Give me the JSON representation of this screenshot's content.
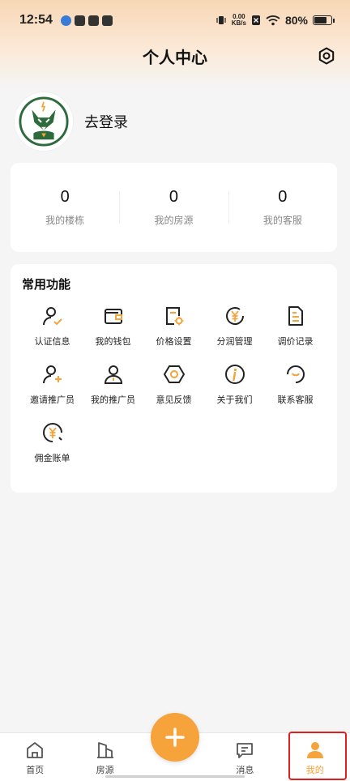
{
  "status_bar": {
    "time": "12:54",
    "net_speed_value": "0.00",
    "net_speed_unit": "KB/s",
    "battery": "80%"
  },
  "header": {
    "title": "个人中心"
  },
  "profile": {
    "login_label": "去登录"
  },
  "stats": [
    {
      "value": "0",
      "label": "我的楼栋"
    },
    {
      "value": "0",
      "label": "我的房源"
    },
    {
      "value": "0",
      "label": "我的客服"
    }
  ],
  "functions": {
    "title": "常用功能",
    "items": [
      {
        "label": "认证信息",
        "icon": "user-check-icon"
      },
      {
        "label": "我的钱包",
        "icon": "wallet-icon"
      },
      {
        "label": "价格设置",
        "icon": "price-settings-icon"
      },
      {
        "label": "分润管理",
        "icon": "profit-share-icon"
      },
      {
        "label": "调价记录",
        "icon": "document-icon"
      },
      {
        "label": "邀请推广员",
        "icon": "user-add-icon"
      },
      {
        "label": "我的推广员",
        "icon": "promoter-icon"
      },
      {
        "label": "意见反馈",
        "icon": "hexagon-icon"
      },
      {
        "label": "关于我们",
        "icon": "info-icon"
      },
      {
        "label": "联系客服",
        "icon": "customer-service-icon"
      },
      {
        "label": "佣金账单",
        "icon": "commission-bill-icon"
      }
    ]
  },
  "nav": {
    "items": [
      {
        "label": "首页",
        "icon": "home-icon"
      },
      {
        "label": "房源",
        "icon": "building-icon"
      },
      {
        "label": "消息",
        "icon": "message-icon"
      },
      {
        "label": "我的",
        "icon": "user-icon"
      }
    ],
    "active": "我的"
  },
  "colors": {
    "accent": "#f5a33a",
    "highlight": "#e21d1d"
  }
}
